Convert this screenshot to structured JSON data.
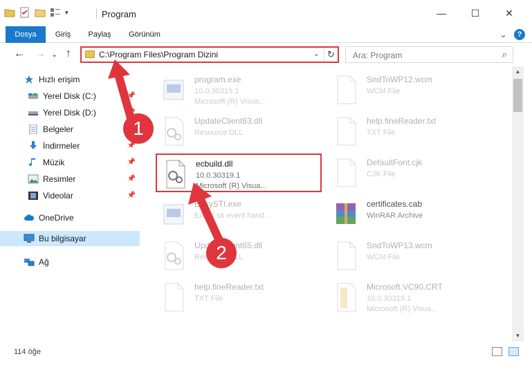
{
  "window": {
    "title": "Program",
    "minimize": "—",
    "maximize": "☐",
    "close": "✕"
  },
  "ribbon": {
    "tabs": [
      "Dosya",
      "Giriş",
      "Paylaş",
      "Görünüm"
    ],
    "collapse": "⌄",
    "help": "?"
  },
  "nav": {
    "back": "←",
    "forward": "→",
    "recent": "⌄",
    "up": "↑",
    "address_path": "C:\\Program Files\\Program Dizini",
    "address_dropdown": "⌄",
    "refresh": "↻",
    "search_placeholder": "Ara: Program",
    "search_icon": "⌕"
  },
  "sidebar": {
    "items": [
      {
        "label": "Hızlı erişim",
        "icon": "star-icon"
      },
      {
        "label": "Yerel Disk (C:)",
        "icon": "drive-icon"
      },
      {
        "label": "Yerel Disk (D:)",
        "icon": "drive-icon"
      },
      {
        "label": "Belgeler",
        "icon": "documents-icon"
      },
      {
        "label": "İndirmeler",
        "icon": "download-icon"
      },
      {
        "label": "Müzik",
        "icon": "music-icon"
      },
      {
        "label": "Resimler",
        "icon": "pictures-icon"
      },
      {
        "label": "Videolar",
        "icon": "video-icon"
      },
      {
        "label": "OneDrive",
        "icon": "cloud-icon"
      },
      {
        "label": "Bu bilgisayar",
        "icon": "computer-icon"
      },
      {
        "label": "Ağ",
        "icon": "network-icon"
      }
    ]
  },
  "files": [
    {
      "name": "program.exe",
      "line1": "10.0.30319.1",
      "line2": "Microsoft (R) Visua...",
      "icon": "exe-icon"
    },
    {
      "name": "SndToWP12.wcm",
      "line1": "WCM File",
      "line2": "",
      "icon": "blank-file-icon"
    },
    {
      "name": "UpdateClient63.dll",
      "line1": "Resource DLL",
      "line2": "",
      "icon": "dll-icon"
    },
    {
      "name": "help.fineReader.txt",
      "line1": "TXT File",
      "line2": "",
      "icon": "blank-file-icon"
    },
    {
      "name": "ecbuild.dll",
      "line1": "10.0.30319.1",
      "line2": "Microsoft (R) Visua...",
      "icon": "dll-icon"
    },
    {
      "name": "DefaultFont.cjk",
      "line1": "CJK File",
      "line2": "",
      "icon": "blank-file-icon"
    },
    {
      "name": "EasySTI.exe",
      "line1": "EASY sti event hand...",
      "line2": "",
      "icon": "exe-icon"
    },
    {
      "name": "certificates.cab",
      "line1": "WinRAR Archive",
      "line2": "",
      "icon": "archive-icon"
    },
    {
      "name": "UpdateClient65.dll",
      "line1": "Resource DLL",
      "line2": "",
      "icon": "dll-icon"
    },
    {
      "name": "SndToWP13.wcm",
      "line1": "WCM File",
      "line2": "",
      "icon": "blank-file-icon"
    },
    {
      "name": "help.fineReader.txt",
      "line1": "TXT File",
      "line2": "",
      "icon": "blank-file-icon"
    },
    {
      "name": "Microsoft.VC90.CRT",
      "line1": "10.0.30319.1",
      "line2": "Microsoft (R) Visua...",
      "icon": "blank-file-icon"
    }
  ],
  "status": {
    "count": "114 öğe"
  },
  "annotations": {
    "step1": "1",
    "step2": "2"
  },
  "colors": {
    "accent": "#1979ca",
    "highlight": "#e0353c",
    "selection": "#cce8ff"
  }
}
